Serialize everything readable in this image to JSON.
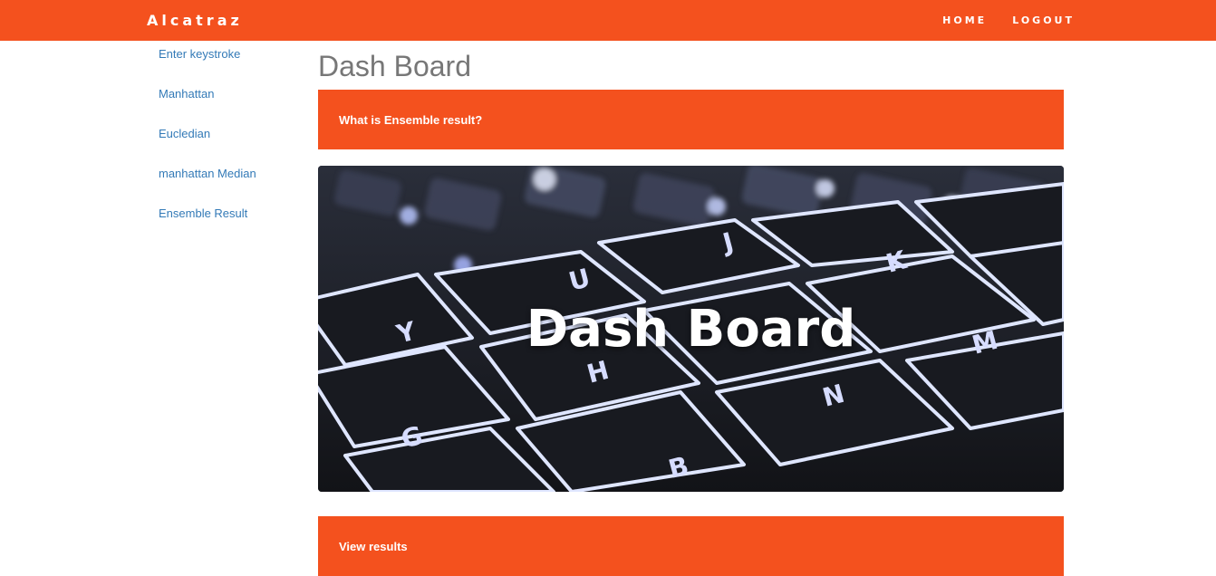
{
  "navbar": {
    "brand": "Alcatraz",
    "links": [
      {
        "label": "HOME"
      },
      {
        "label": "LOGOUT"
      }
    ]
  },
  "sidebar": {
    "items": [
      {
        "label": "Enter keystroke"
      },
      {
        "label": "Manhattan"
      },
      {
        "label": "Eucledian"
      },
      {
        "label": "manhattan Median"
      },
      {
        "label": "Ensemble Result"
      }
    ]
  },
  "main": {
    "title": "Dash Board",
    "info_panel": "What is Ensemble result?",
    "hero_title": "Dash Board",
    "hero_keys": [
      "U",
      "K",
      "Y",
      "H",
      "N",
      "M",
      "G",
      "B",
      "J"
    ],
    "results_panel": "View results"
  },
  "colors": {
    "accent": "#f4511e",
    "link": "#337ab7",
    "title": "#777777"
  }
}
